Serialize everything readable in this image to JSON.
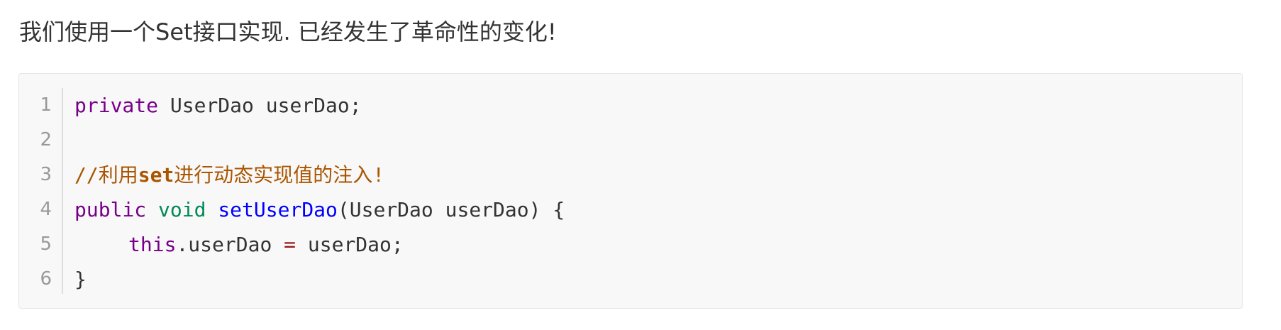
{
  "intro": {
    "text": "我们使用一个Set接口实现. 已经发生了革命性的变化!"
  },
  "code": {
    "line_numbers": [
      "1",
      "2",
      "3",
      "4",
      "5",
      "6"
    ],
    "line1": {
      "kw": "private",
      "rest": " UserDao userDao;"
    },
    "line3": {
      "comment_prefix": "//利用",
      "comment_bold": "set",
      "comment_suffix": "进行动态实现值的注入!"
    },
    "line4": {
      "kw": "public",
      "type": "void",
      "fn": "setUserDao",
      "rest": "(UserDao userDao) {"
    },
    "line5": {
      "kw": "this",
      "mid": ".userDao ",
      "op": "=",
      "rest": " userDao;"
    },
    "line6": {
      "rest": "}"
    }
  }
}
